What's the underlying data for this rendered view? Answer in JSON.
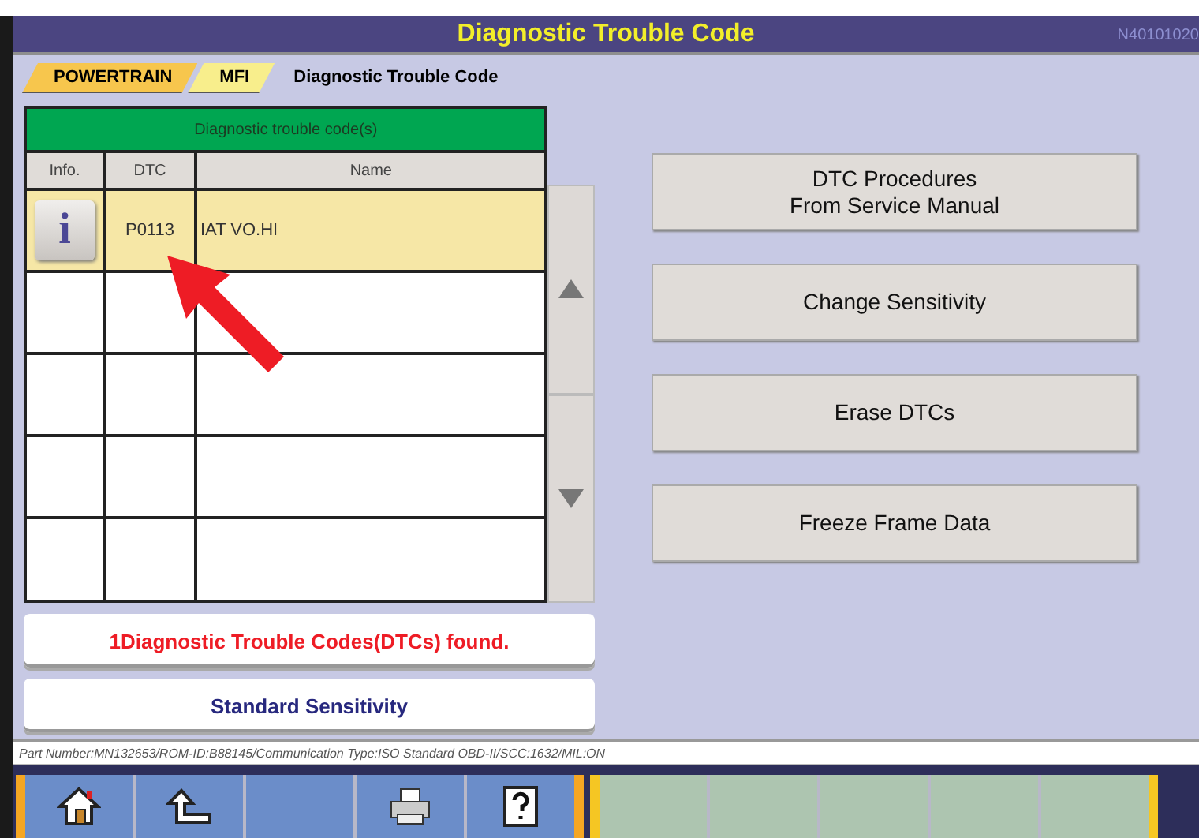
{
  "window": {
    "title": "Diagnostic Trouble Code",
    "screen_code": "N40101020"
  },
  "breadcrumb": [
    {
      "label": "POWERTRAIN",
      "kind": "tab"
    },
    {
      "label": "MFI",
      "kind": "tab"
    },
    {
      "label": "Diagnostic Trouble Code",
      "kind": "current"
    }
  ],
  "table": {
    "title": "Diagnostic trouble code(s)",
    "columns": [
      "Info.",
      "DTC",
      "Name"
    ],
    "rows": [
      {
        "info": "i",
        "dtc": "P0113",
        "name": "IAT VO.HI",
        "selected": true
      }
    ]
  },
  "messages": [
    {
      "text": "1Diagnostic Trouble Codes(DTCs) found.",
      "kind": "alert"
    },
    {
      "text": "Standard Sensitivity",
      "kind": "info"
    }
  ],
  "actions": [
    "DTC Procedures\nFrom Service Manual",
    "Change Sensitivity",
    "Erase DTCs",
    "Freeze Frame Data"
  ],
  "status_bar": "Part Number:MN132653/ROM-ID:B88145/Communication Type:ISO Standard OBD-II/SCC:1632/MIL:ON",
  "toolbar": [
    {
      "kind": "home"
    },
    {
      "kind": "up"
    },
    {
      "kind": "blank"
    },
    {
      "kind": "printer"
    },
    {
      "kind": "help"
    }
  ]
}
